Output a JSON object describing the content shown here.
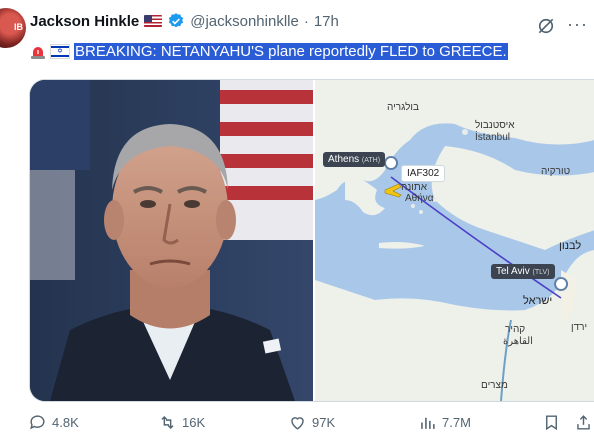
{
  "tweet": {
    "author_name": "Jackson Hinkle",
    "handle": "@jacksonhinklle",
    "separator": "·",
    "time": "17h",
    "text": "BREAKING: NETANYAHU'S plane reportedly FLED to GREECE."
  },
  "avatar": {
    "overlay": "IB"
  },
  "map": {
    "labels": {
      "bulgaria": "בולגריה",
      "istanbul_he": "איסטנבול",
      "istanbul": "İstanbul",
      "turkey": "טורקיה",
      "athens_he": "אתונה",
      "athens_local": "Αθήνα",
      "lebanon": "לבנון",
      "israel": "ישראל",
      "jordan": "ירדן",
      "cairo_he": "קהיר",
      "cairo_ar": "القاهرة",
      "egypt": "מצרים"
    },
    "callout_athens": {
      "name": "Athens",
      "code": "(ATH)"
    },
    "callout_telaviv": {
      "name": "Tel Aviv",
      "code": "(TLV)"
    },
    "flight": "IAF302"
  },
  "actions": {
    "replies": "4.8K",
    "reposts": "16K",
    "likes": "97K",
    "views": "7.7M"
  },
  "colors": {
    "highlight": "#2a5cd6",
    "verified": "#1d9bf0",
    "flight_path": "#4b3fc7",
    "sea": "#a9c8e9",
    "land": "#eef0ea"
  }
}
